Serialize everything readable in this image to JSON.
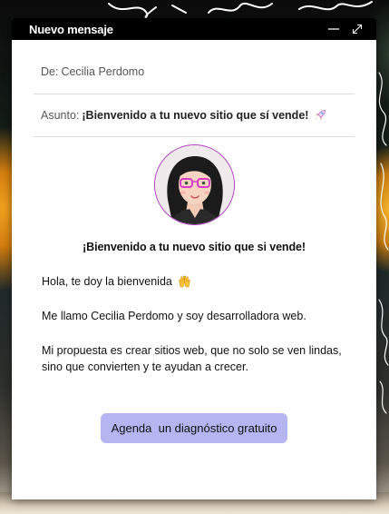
{
  "window": {
    "title": "Nuevo mensaje",
    "minimize_icon": "minimize-icon",
    "expand_icon": "expand-icon"
  },
  "email": {
    "to_label": "De:",
    "to_value": "Cecilia Perdomo",
    "subject_label": "Asunto:",
    "subject_value": "¡Bienvenido a tu nuevo sitio que sí vende!",
    "subject_icon": "rocket-icon"
  },
  "content": {
    "heading": "¡Bienvenido a tu nuevo sitio que si vende!",
    "greeting": "Hola,  te doy la bienvenida",
    "greeting_icon": "raised-hands-icon",
    "intro": "Me llamo Cecilia Perdomo y soy desarrolladora web.",
    "proposal": "Mi propuesta es crear sitios web, que no solo se ven lindas, sino que convierten y te ayudan a crecer.",
    "cta_label": "Agenda  un diagnóstico gratuito"
  },
  "colors": {
    "titlebar": "#000000",
    "avatar_border": "#b03ac0",
    "cta_background": "#b5b5f2"
  }
}
